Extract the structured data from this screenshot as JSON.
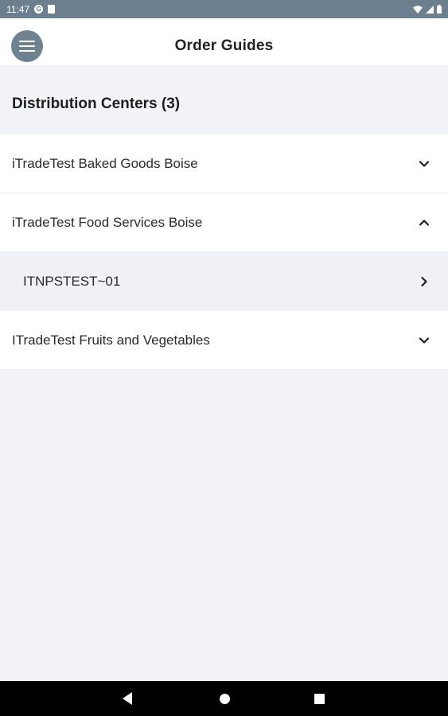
{
  "status_bar": {
    "time": "11:47",
    "icons": [
      "g-icon",
      "sd-card-icon",
      "wifi-icon",
      "signal-icon",
      "battery-icon"
    ]
  },
  "app_bar": {
    "title": "Order Guides",
    "menu_icon": "hamburger-menu-icon"
  },
  "section": {
    "title": "Distribution Centers (3)"
  },
  "list": [
    {
      "label": "iTradeTest Baked Goods Boise",
      "icon": "chevron-down-icon",
      "expanded": false
    },
    {
      "label": "iTradeTest Food Services Boise",
      "icon": "chevron-up-icon",
      "expanded": true
    },
    {
      "label": "ITNPSTEST~01",
      "icon": "chevron-right-icon",
      "sub": true
    },
    {
      "label": "ITradeTest Fruits and Vegetables",
      "icon": "chevron-down-icon",
      "expanded": false
    }
  ],
  "nav_bar": {
    "icons": [
      "back-icon",
      "home-icon",
      "recents-icon"
    ]
  },
  "colors": {
    "status_bar": "#6c7f8e",
    "background": "#f1f3f8",
    "menu_button": "#6e8290"
  }
}
